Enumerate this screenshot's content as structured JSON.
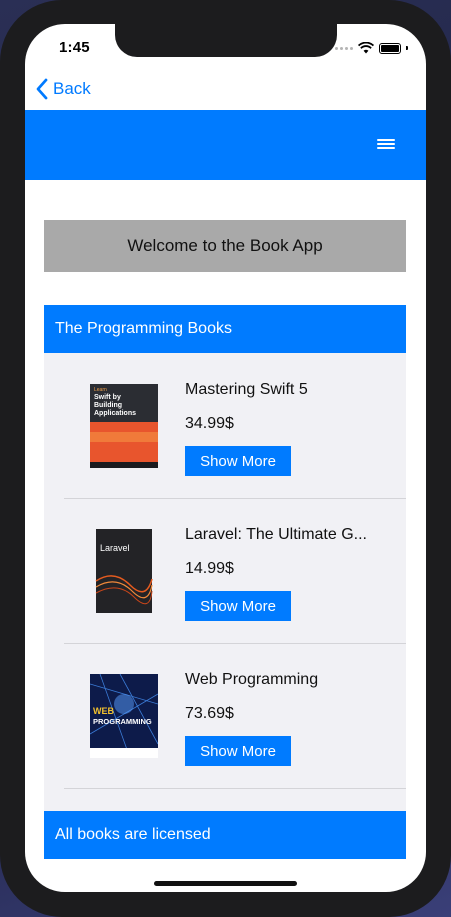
{
  "status_bar": {
    "time": "1:45"
  },
  "nav": {
    "back_label": "Back"
  },
  "welcome_text": "Welcome to the Book App",
  "section_title": "The Programming Books",
  "books": [
    {
      "title": "Mastering Swift 5",
      "price": "34.99$",
      "button": "Show More",
      "cover_text": [
        "Learn",
        "Swift by",
        "Building",
        "Applications"
      ]
    },
    {
      "title": "Laravel: The Ultimate G...",
      "price": "14.99$",
      "button": "Show More",
      "cover_text": [
        "Laravel"
      ]
    },
    {
      "title": "Web Programming",
      "price": "73.69$",
      "button": "Show More",
      "cover_text": [
        "WEB",
        "PROGRAMMING"
      ]
    }
  ],
  "footer_text": "All books are licensed",
  "colors": {
    "accent": "#007bff",
    "ios_blue": "#007aff",
    "welcome_bg": "#a9a9a9",
    "list_bg": "#f1f1f5"
  }
}
